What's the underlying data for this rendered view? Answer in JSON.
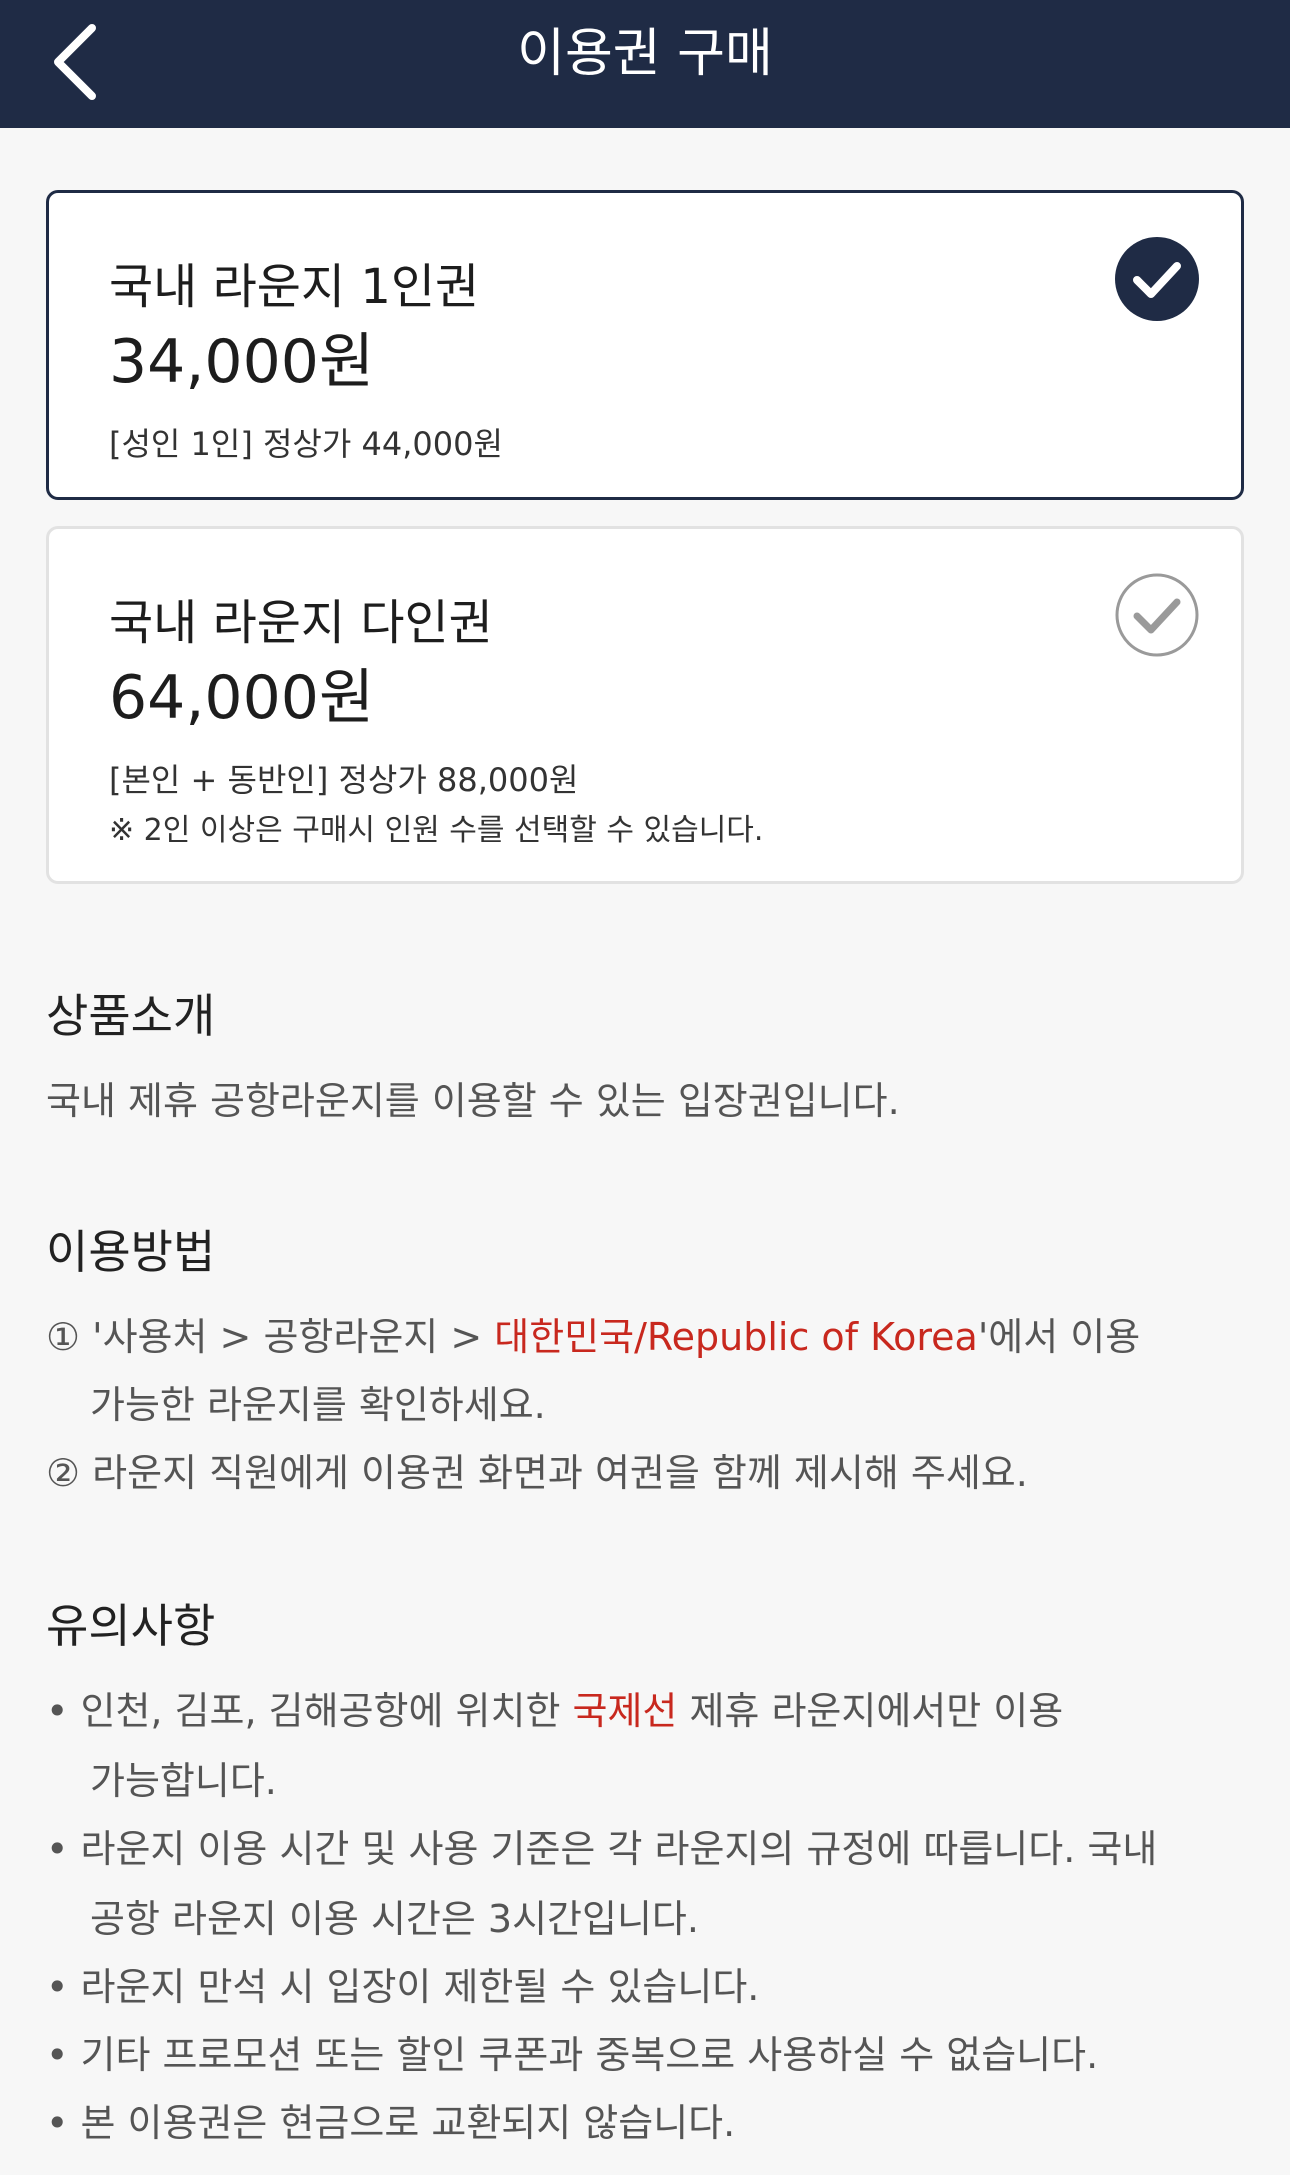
{
  "header": {
    "title": "이용권 구매",
    "back_icon": "chevron-left-icon"
  },
  "products": [
    {
      "name": "국내 라운지 1인권",
      "price": "34,000원",
      "note_1": "[성인 1인] 정상가 44,000원",
      "selected": true
    },
    {
      "name": "국내 라운지 다인권",
      "price": "64,000원",
      "note_1": "[본인 + 동반인] 정상가 88,000원",
      "note_2": "※ 2인 이상은 구매시 인원 수를 선택할 수 있습니다.",
      "selected": false
    }
  ],
  "intro": {
    "title": "상품소개",
    "text": "국내 제휴 공항라운지를 이용할 수 있는 입장권입니다."
  },
  "usage": {
    "title": "이용방법",
    "step1_prefix": "① '사용처 > 공항라운지 > ",
    "step1_highlight": "대한민국/Republic of Korea",
    "step1_suffix": "'에서 이용",
    "step1_cont": "가능한 라운지를 확인하세요.",
    "step2": "② 라운지 직원에게 이용권 화면과 여권을 함께 제시해 주세요."
  },
  "notice": {
    "title": "유의사항",
    "item1_prefix": "• 인천, 김포, 김해공항에 위치한 ",
    "item1_highlight": "국제선",
    "item1_suffix": " 제휴 라운지에서만 이용",
    "item1_cont": "가능합니다.",
    "item2": "• 라운지 이용 시간 및 사용 기준은 각 라운지의 규정에 따릅니다. 국내",
    "item2_cont": "공항 라운지 이용 시간은 3시간입니다.",
    "item3": "• 라운지 만석 시 입장이 제한될 수 있습니다.",
    "item4": "• 기타 프로모션 또는 할인 쿠폰과 중복으로 사용하실 수 없습니다.",
    "item5": "• 본 이용권은 현금으로 교환되지 않습니다."
  },
  "colors": {
    "header_bg": "#1f2b45",
    "highlight": "#c8281e",
    "check_selected": "#1f2b45"
  }
}
